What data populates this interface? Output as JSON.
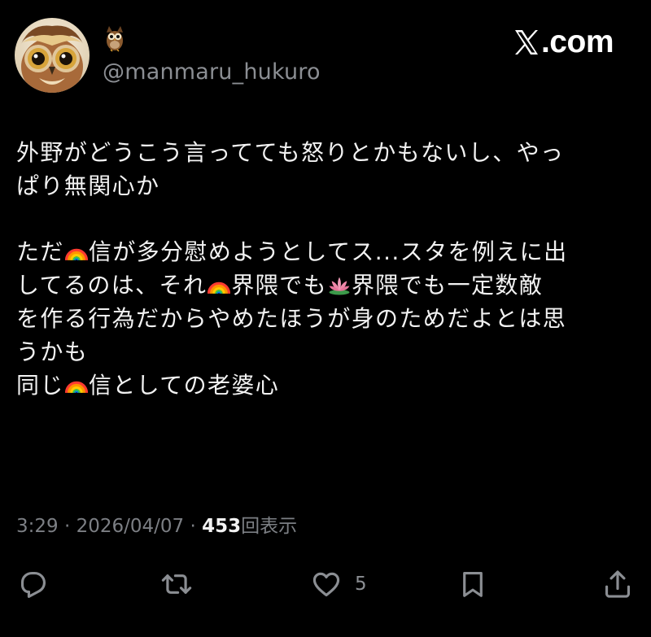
{
  "post": {
    "display_name_icon": "owl-emoji",
    "handle": "@manmaru_hukuro",
    "brand": "X.com",
    "lines": {
      "l1": "外野がどうこう言ってても怒りとかもないし、やっ",
      "l2": "ぱり無関心か",
      "l3a": "ただ",
      "l3b": "信が多分慰めようとしてス...スタを例えに出",
      "l4a": "してるのは、それ",
      "l4b": "界隈でも",
      "l4c": "界隈でも一定数敵",
      "l5": "を作る行為だからやめたほうが身のためだよとは思",
      "l6": "うかも",
      "l7a": "同じ",
      "l7b": "信としての老婆心"
    },
    "emojis": [
      "rainbow-emoji",
      "lotus-emoji"
    ]
  },
  "meta": {
    "time": "3:29",
    "sep1": " · ",
    "date": "2026/04/07",
    "sep2": " · ",
    "views_count": "453",
    "views_label": "回表示"
  },
  "actions": {
    "reply_icon": "reply-icon",
    "repost_icon": "repost-icon",
    "like_icon": "heart-icon",
    "like_count": "5",
    "bookmark_icon": "bookmark-icon",
    "share_icon": "share-icon"
  },
  "colors": {
    "background": "#000000",
    "text": "#f2f2f2",
    "muted": "#8b8e93"
  }
}
